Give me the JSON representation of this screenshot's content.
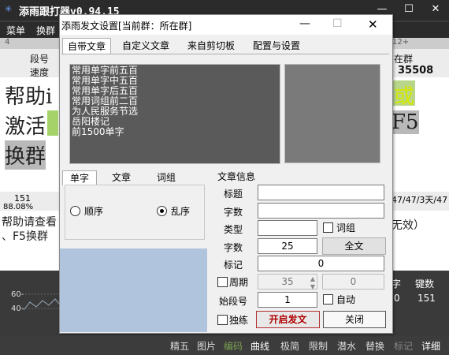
{
  "app": {
    "title": "添雨跟打器v0.94.15",
    "menu": [
      "菜单",
      "换群"
    ]
  },
  "main": {
    "ruler": {
      "left": "4",
      "right": "12+"
    },
    "labels": {
      "duan": "段号",
      "speed": "速度",
      "zaiqun": "在群",
      "speed_value": "35508"
    },
    "bigtext": [
      "帮助i",
      "激活",
      "换群"
    ],
    "right_bigtext": [
      "或",
      "F5"
    ],
    "stat_left": "151",
    "stat_percent": "88.08%",
    "stat_right": "47/47/3天/47",
    "input_lines": [
      "帮助请查看",
      "、F5换群"
    ],
    "input_right": "无效）",
    "chart_ticks": [
      "60-",
      "40-"
    ],
    "bottom_labels": [
      "字",
      "键数"
    ],
    "bottom_values": [
      "0",
      "151"
    ],
    "bottom_bar": [
      "精五",
      "图片",
      "编码",
      "曲线",
      "极简",
      "限制",
      "潜水",
      "替换",
      "标记",
      "详细"
    ]
  },
  "dialog": {
    "title": "添雨发文设置[当前群：所在群]",
    "tabs": [
      "自带文章",
      "自定义文章",
      "来自剪切板",
      "配置与设置"
    ],
    "articles": [
      "常用单字前五百",
      "常用单字中五百",
      "常用单字后五百",
      "常用词组前二百",
      "为人民服务节选",
      "岳阳楼记",
      "前1500单字"
    ],
    "subtabs": [
      "单字",
      "文章",
      "词组"
    ],
    "radio": {
      "order": "顺序",
      "random": "乱序"
    },
    "info_title": "文章信息",
    "fields": {
      "title_label": "标题",
      "title_value": "",
      "count_label": "字数",
      "count_value": "",
      "type_label": "类型",
      "type_value": "",
      "ci_label": "词组",
      "seg_label": "字数",
      "seg_value": "25",
      "full_btn": "全文",
      "mark_label": "标记",
      "mark_value": "0",
      "cycle_label": "周期",
      "cycle_value": "35",
      "cycle_right": "0",
      "start_label": "始段号",
      "start_value": "1",
      "auto_label": "自动",
      "solo_label": "独练",
      "start_btn": "开启发文",
      "close_btn": "关闭"
    }
  }
}
